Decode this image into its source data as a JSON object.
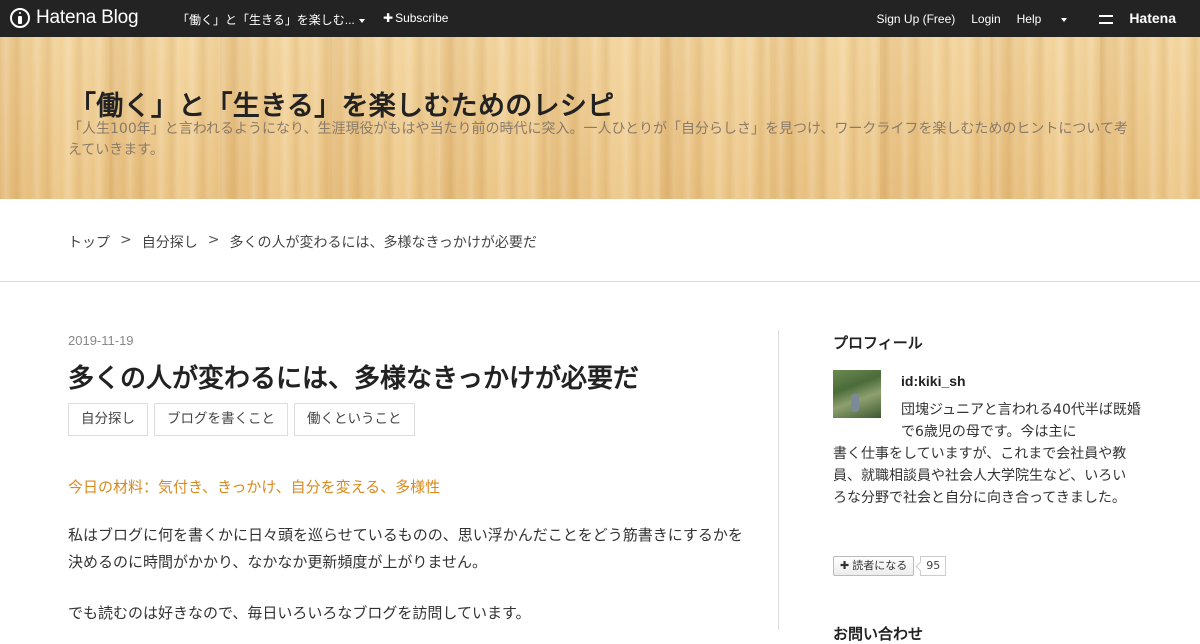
{
  "topbar": {
    "logo_text": "Hatena Blog",
    "blog_name": "「働く」と「生きる」を楽しむ...",
    "subscribe_label": "Subscribe",
    "signup_label": "Sign Up (Free)",
    "login_label": "Login",
    "help_label": "Help",
    "hatena_label": "Hatena"
  },
  "header": {
    "title": "「働く」と「生きる」を楽しむためのレシピ",
    "description": "「人生100年」と言われるようになり、生涯現役がもはや当たり前の時代に突入。一人ひとりが「自分らしさ」を見つけ、ワークライフを楽しむためのヒントについて考えていきます。"
  },
  "breadcrumb": {
    "items": [
      "トップ",
      "自分探し",
      "多くの人が変わるには、多様なきっかけが必要だ"
    ],
    "separator": ">"
  },
  "article": {
    "date": "2019-11-19",
    "title": "多くの人が変わるには、多様なきっかけが必要だ",
    "tags": [
      "自分探し",
      "ブログを書くこと",
      "働くということ"
    ],
    "materials": "今日の材料：気付き、きっかけ、自分を変える、多様性",
    "paragraphs": [
      "私はブログに何を書くかに日々頭を巡らせているものの、思い浮かんだことをどう筋書きにするかを決めるのに時間がかかり、なかなか更新頻度が上がりません。",
      "でも読むのは好きなので、毎日いろいろなブログを訪問しています。"
    ]
  },
  "sidebar": {
    "profile_heading": "プロフィール",
    "user_id": "id:kiki_sh",
    "bio_part1": "団塊ジュニアと言われる40代半ば既婚で6歳児の母です。今は主に",
    "bio_part2": "書く仕事をしていますが、これまで会社員や教員、就職相談員や社会人大学院生など、いろいろな分野で社会と自分に向き合ってきました。",
    "subscribe_label": "読者になる",
    "reader_count": "95",
    "next_heading": "お問い合わせ"
  },
  "colors": {
    "topbar_bg": "#232323",
    "materials_text": "#d98a1c",
    "header_wood": "#eec98c"
  }
}
